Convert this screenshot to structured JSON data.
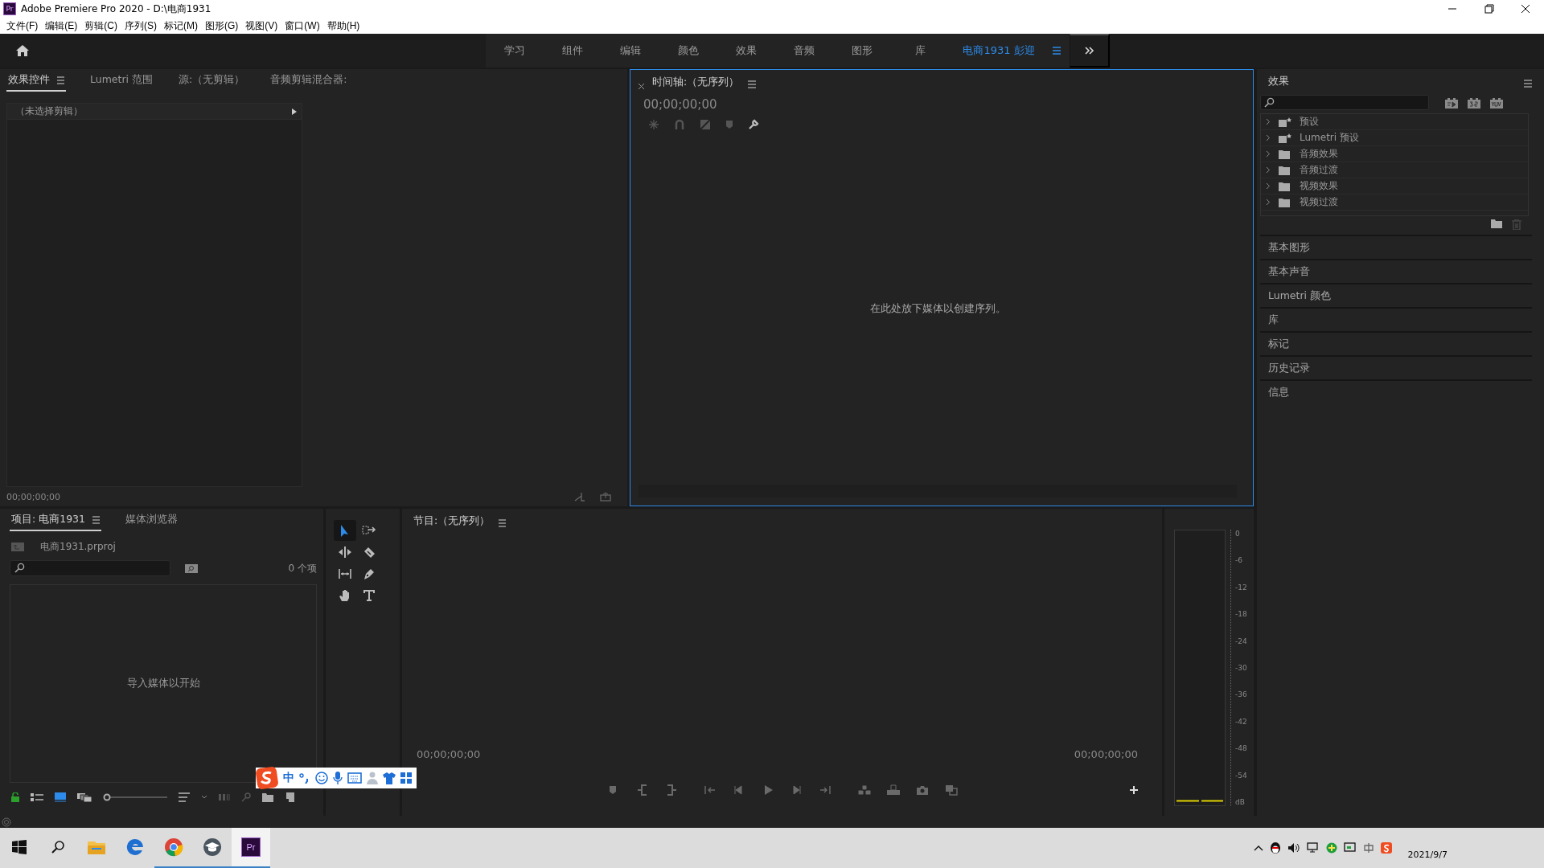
{
  "window": {
    "title": "Adobe Premiere Pro 2020 - D:\\电商1931",
    "app_badge": "Pr"
  },
  "menu": [
    "文件(F)",
    "编辑(E)",
    "剪辑(C)",
    "序列(S)",
    "标记(M)",
    "图形(G)",
    "视图(V)",
    "窗口(W)",
    "帮助(H)"
  ],
  "workspaces": [
    {
      "label": "学习",
      "selected": false
    },
    {
      "label": "组件",
      "selected": false
    },
    {
      "label": "编辑",
      "selected": false
    },
    {
      "label": "颜色",
      "selected": false
    },
    {
      "label": "效果",
      "selected": false
    },
    {
      "label": "音频",
      "selected": false
    },
    {
      "label": "图形",
      "selected": false
    },
    {
      "label": "库",
      "selected": false
    },
    {
      "label": "电商1931  彭迎",
      "selected": true
    }
  ],
  "effect_controls": {
    "tabs": [
      {
        "label": "效果控件",
        "selected": true,
        "menu": true
      },
      {
        "label": "Lumetri 范围",
        "selected": false,
        "menu": false
      },
      {
        "label": "源:（无剪辑）",
        "selected": false,
        "menu": false
      },
      {
        "label": "音频剪辑混合器:",
        "selected": false,
        "menu": false
      }
    ],
    "clip": "（未选择剪辑）",
    "timecode": "00;00;00;00"
  },
  "timeline": {
    "title": "时间轴:（无序列）",
    "timecode": "00;00;00;00",
    "message": "在此处放下媒体以创建序列。"
  },
  "effects": {
    "title": "效果",
    "tree": [
      {
        "label": "预设",
        "kind": "preset"
      },
      {
        "label": "Lumetri 预设",
        "kind": "preset"
      },
      {
        "label": "音频效果",
        "kind": "folder"
      },
      {
        "label": "音频过渡",
        "kind": "folder"
      },
      {
        "label": "视频效果",
        "kind": "folder"
      },
      {
        "label": "视频过渡",
        "kind": "folder"
      }
    ],
    "sections": [
      "基本图形",
      "基本声音",
      "Lumetri 颜色",
      "库",
      "标记",
      "历史记录",
      "信息"
    ]
  },
  "project": {
    "tabs": [
      {
        "label": "项目: 电商1931",
        "selected": true
      },
      {
        "label": "媒体浏览器",
        "selected": false
      }
    ],
    "file": "电商1931.prproj",
    "count": "0 个项",
    "message": "导入媒体以开始",
    "zoom_slider": {
      "level": 0
    }
  },
  "tools": [
    {
      "kind": "selection",
      "selected": true
    },
    {
      "kind": "track-select",
      "selected": false
    },
    {
      "kind": "ripple",
      "selected": false
    },
    {
      "kind": "razor",
      "selected": false
    },
    {
      "kind": "slip",
      "selected": false
    },
    {
      "kind": "pen",
      "selected": false
    },
    {
      "kind": "hand",
      "selected": false
    },
    {
      "kind": "type",
      "selected": false
    }
  ],
  "program": {
    "title": "节目:（无序列）",
    "timecode_left": "00;00;00;00",
    "timecode_right": "00;00;00;00"
  },
  "audio_meter": {
    "scale": [
      "0",
      "-6",
      "-12",
      "-18",
      "-24",
      "-30",
      "-36",
      "-42",
      "-48",
      "-54"
    ],
    "unit": "dB"
  },
  "ime": {
    "mode": "中"
  },
  "taskbar": {
    "apps": [
      {
        "kind": "explorer",
        "running": false,
        "selected": false
      },
      {
        "kind": "edge",
        "running": false,
        "selected": false
      },
      {
        "kind": "chrome",
        "running": true,
        "selected": false
      },
      {
        "kind": "school",
        "running": true,
        "selected": false
      },
      {
        "kind": "premiere",
        "label": "Pr",
        "running": true,
        "selected": true
      }
    ],
    "date": "2021/9/7"
  }
}
